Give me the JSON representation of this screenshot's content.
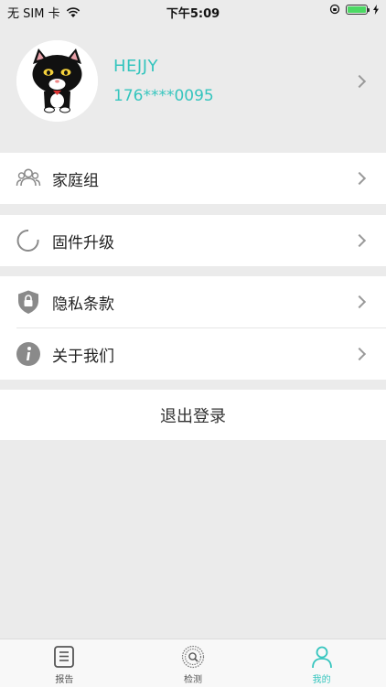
{
  "status_bar": {
    "carrier": "无 SIM 卡",
    "time": "下午5:09",
    "battery_color": "#4cd964"
  },
  "profile": {
    "username": "HEJJY",
    "phone": "176****0095",
    "accent_color": "#35c5be"
  },
  "menu": {
    "family_group": "家庭组",
    "firmware_upgrade": "固件升级",
    "privacy_policy": "隐私条款",
    "about_us": "关于我们"
  },
  "logout_label": "退出登录",
  "tabbar": {
    "tabs": [
      {
        "label": "报告",
        "icon": "report-icon"
      },
      {
        "label": "检测",
        "icon": "scan-icon"
      },
      {
        "label": "我的",
        "icon": "user-icon",
        "active": true
      }
    ]
  }
}
